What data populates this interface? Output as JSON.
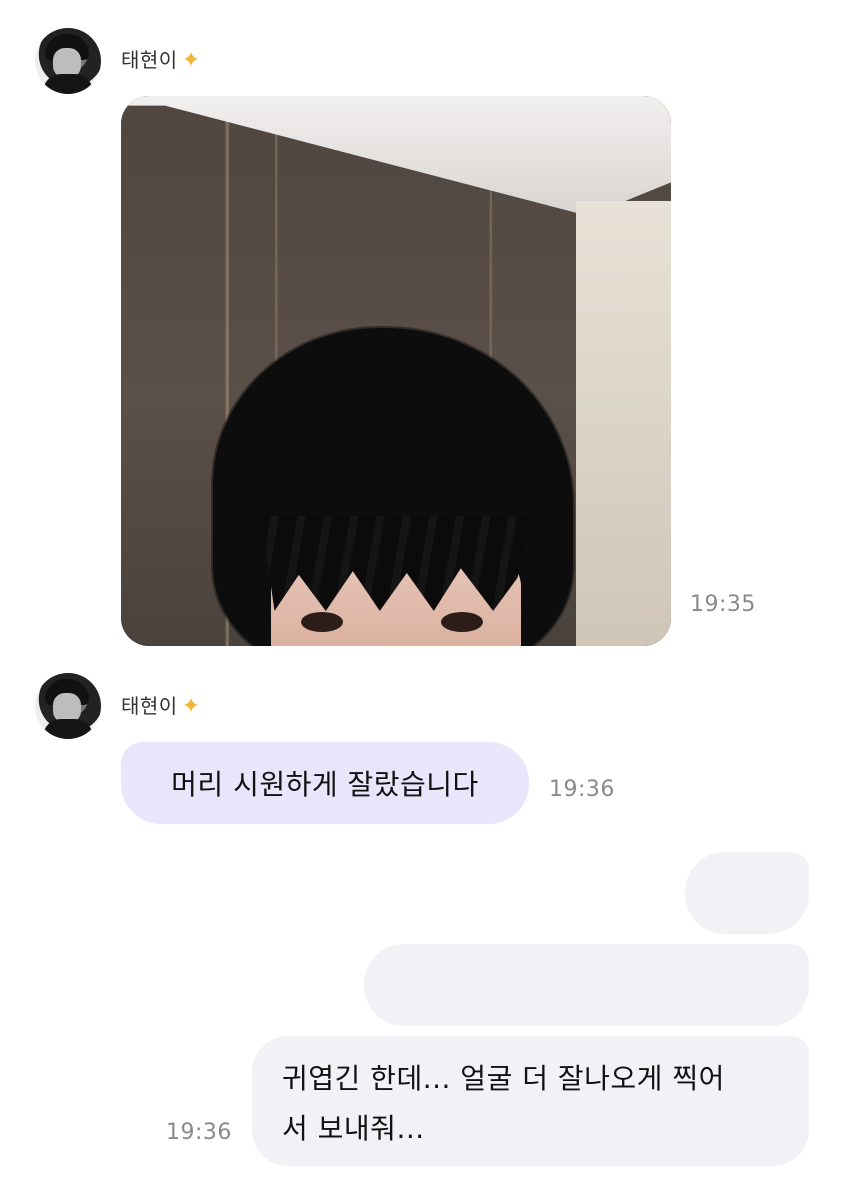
{
  "messages": [
    {
      "sender": "태현이",
      "badge_icon": "crown-icon",
      "type": "image",
      "time": "19:35"
    },
    {
      "sender": "태현이",
      "badge_icon": "crown-icon",
      "type": "text",
      "text": "머리 시원하게 잘랐습니다",
      "time": "19:36"
    },
    {
      "type": "outgoing-blank"
    },
    {
      "type": "outgoing-blank"
    },
    {
      "type": "outgoing-text",
      "text": "귀엽긴 한데... 얼굴 더 잘나오게 찍어\n서 보내줘...",
      "time": "19:36"
    }
  ],
  "colors": {
    "incoming_bubble": "#e9e6fb",
    "outgoing_bubble": "#f2f2f6",
    "time_text": "#8a8a8a",
    "badge": "#f2b636"
  }
}
